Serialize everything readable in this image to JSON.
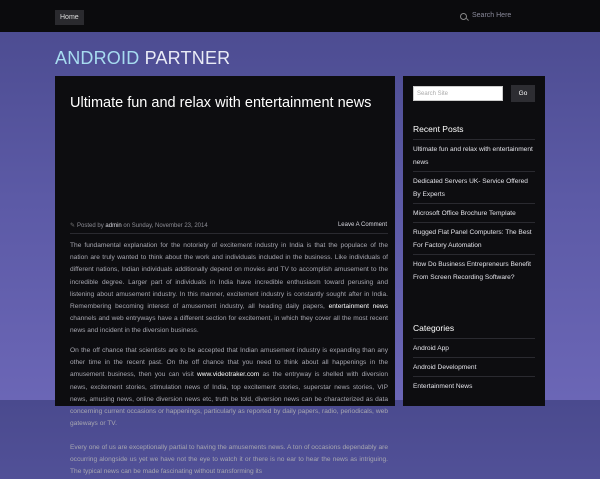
{
  "topbar": {
    "home_label": "Home",
    "search_placeholder": "Search Here"
  },
  "site": {
    "title_a": "ANDROID",
    "title_b": " PARTNER"
  },
  "post": {
    "title": "Ultimate fun and relax with entertainment news",
    "meta_prefix": "Posted by ",
    "author": "admin",
    "meta_on": " on Sunday, November 23, 2014",
    "comment_label": "Leave A Comment",
    "p1_a": "The fundamental explanation for the notoriety of excitement industry in India is that the populace of the nation are truly wanted to think about the work and individuals included in the business. Like individuals of different nations, Indian individuals additionally depend on movies and TV to accomplish amusement to the incredible degree. Larger part of individuals in India have incredible enthusiasm toward perusing and listening about amusement industry. In this manner, excitement industry is constantly sought after in India. Remembering becoming interest of amusement industry, all heading daily papers, ",
    "p1_link": "entertainment news",
    "p1_b": " channels and web entryways have a different section for excitement, in which they cover all the most recent news and incident in the diversion business.",
    "p2_a": "On the off chance that scientists are to be accepted that Indian amusement industry is expanding than any other time in the recent past. On the off chance that you need to think about all happenings in the amusement business, then you can visit ",
    "p2_link": "www.videotraker.com",
    "p2_b": " as the entryway is shelled with diversion news, excitement stories, stimulation news of  India, top excitement stories, superstar news stories, VIP news, amusing news, online diversion news etc, truth be told, diversion news can be characterized as data concerning current occasions or happenings, particularly as reported by daily papers, radio, periodicals, web gateways or TV.",
    "p3": "Every one of us are exceptionally partial to having the amusements news. A ton of occasions dependably are occurring alongside us yet we have not the eye to watch it or there is no ear to hear the news as intriguing. The typical news can be made fascinating without transforming its"
  },
  "sidebar": {
    "search_placeholder": "Search Site",
    "go_label": "Go",
    "recent_title": "Recent Posts",
    "recent": [
      "Ultimate fun and relax with entertainment news",
      "Dedicated Servers UK- Service Offered By Experts",
      "Microsoft Office Brochure Template",
      "Rugged Flat Panel Computers: The Best For Factory Automation",
      "How Do Business Entrepreneurs Benefit From Screen Recording Software?"
    ],
    "categories_title": "Categories",
    "categories": [
      "Android App",
      "Android Development",
      "Entertainment News"
    ]
  }
}
